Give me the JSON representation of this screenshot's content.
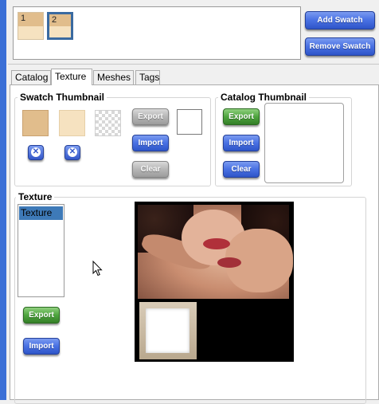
{
  "swatches": {
    "items": [
      {
        "number": "1",
        "top_color": "#e1bd8c",
        "bottom_color": "#f6e2c0",
        "selected": false
      },
      {
        "number": "2",
        "top_color": "#e1bd8c",
        "bottom_color": "#f6e2c0",
        "selected": true
      }
    ],
    "add_label": "Add Swatch",
    "remove_label": "Remove Swatch"
  },
  "tabs": [
    {
      "label": "Catalog",
      "active": false
    },
    {
      "label": "Texture",
      "active": true
    },
    {
      "label": "Meshes",
      "active": false
    },
    {
      "label": "Tags",
      "active": false
    }
  ],
  "swatch_thumbnail": {
    "title": "Swatch Thumbnail",
    "color_1": "#e1bd8c",
    "color_2": "#f6e2c0",
    "export_label": "Export",
    "import_label": "Import",
    "clear_label": "Clear",
    "clear_icon": "x-circle-icon"
  },
  "catalog_thumbnail": {
    "title": "Catalog Thumbnail",
    "export_label": "Export",
    "import_label": "Import",
    "clear_label": "Clear"
  },
  "texture": {
    "title": "Texture",
    "list_items": [
      "Texture"
    ],
    "selected_index": 0,
    "export_label": "Export",
    "import_label": "Import"
  },
  "colors": {
    "accent_blue": "#3b6fd6",
    "selection": "#3e7ab8",
    "green_button": "#4ea53e"
  }
}
